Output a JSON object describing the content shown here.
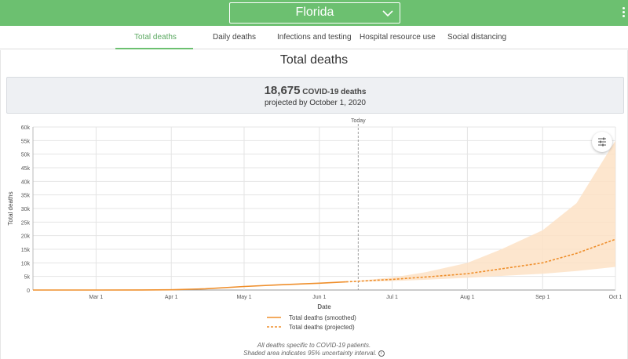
{
  "header": {
    "state_select": {
      "value": "Florida"
    }
  },
  "tabs": [
    {
      "label": "Total deaths",
      "active": true
    },
    {
      "label": "Daily deaths",
      "active": false
    },
    {
      "label": "Infections and testing",
      "active": false
    },
    {
      "label": "Hospital resource use",
      "active": false
    },
    {
      "label": "Social distancing",
      "active": false
    }
  ],
  "main": {
    "title": "Total deaths",
    "summary": {
      "count": "18,675",
      "unit": "COVID-19 deaths",
      "subtitle": "projected by October 1, 2020"
    },
    "notes": [
      "All deaths specific to COVID-19 patients.",
      "Shaded area indicates 95% uncertainty interval."
    ]
  },
  "colors": {
    "brand": "#6cc070",
    "series": "#ef8f2c",
    "band": "#fde2c6"
  },
  "chart_data": {
    "type": "line",
    "xlabel": "Date",
    "ylabel": "Total deaths",
    "ylim": [
      0,
      60000
    ],
    "yticks": [
      0,
      5000,
      10000,
      15000,
      20000,
      25000,
      30000,
      35000,
      40000,
      45000,
      50000,
      55000,
      60000
    ],
    "ytick_labels": [
      "0",
      "5k",
      "10k",
      "15k",
      "20k",
      "25k",
      "30k",
      "35k",
      "40k",
      "45k",
      "50k",
      "55k",
      "60k"
    ],
    "xlim": [
      "2020-02-04",
      "2020-10-01"
    ],
    "xticks": [
      "2020-03-01",
      "2020-04-01",
      "2020-05-01",
      "2020-06-01",
      "2020-07-01",
      "2020-08-01",
      "2020-09-01",
      "2020-10-01"
    ],
    "xtick_labels": [
      "Mar 1",
      "Apr 1",
      "May 1",
      "Jun 1",
      "Jul 1",
      "Aug 1",
      "Sep 1",
      "Oct 1"
    ],
    "today_marker": {
      "label": "Today",
      "date": "2020-06-17"
    },
    "grid": true,
    "legend": "bottom-center",
    "series": [
      {
        "name": "Total deaths (smoothed)",
        "style": "solid",
        "points": [
          [
            "2020-02-04",
            0
          ],
          [
            "2020-03-01",
            0
          ],
          [
            "2020-03-20",
            20
          ],
          [
            "2020-04-01",
            100
          ],
          [
            "2020-04-15",
            450
          ],
          [
            "2020-05-01",
            1300
          ],
          [
            "2020-05-15",
            1900
          ],
          [
            "2020-06-01",
            2500
          ],
          [
            "2020-06-12",
            3000
          ]
        ]
      },
      {
        "name": "Total deaths (projected)",
        "style": "dashed",
        "points": [
          [
            "2020-06-12",
            3000
          ],
          [
            "2020-07-01",
            3900
          ],
          [
            "2020-07-15",
            4800
          ],
          [
            "2020-08-01",
            6000
          ],
          [
            "2020-08-15",
            7800
          ],
          [
            "2020-09-01",
            10000
          ],
          [
            "2020-09-15",
            13500
          ],
          [
            "2020-10-01",
            18675
          ]
        ]
      }
    ],
    "uncertainty_band": {
      "points": [
        [
          "2020-06-12",
          3000,
          3000
        ],
        [
          "2020-07-01",
          3300,
          4600
        ],
        [
          "2020-07-15",
          3800,
          6600
        ],
        [
          "2020-08-01",
          4500,
          10000
        ],
        [
          "2020-08-15",
          5200,
          15000
        ],
        [
          "2020-09-01",
          6000,
          22000
        ],
        [
          "2020-09-15",
          7000,
          32000
        ],
        [
          "2020-10-01",
          8500,
          55000
        ]
      ]
    }
  }
}
